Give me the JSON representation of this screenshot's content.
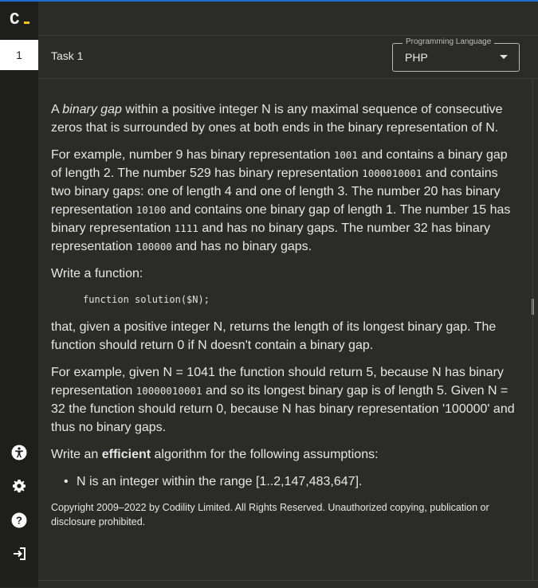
{
  "app": {
    "logo_text": "C",
    "task_number": "1"
  },
  "header": {
    "task_title": "Task 1",
    "language_label": "Programming Language",
    "language_value": "PHP"
  },
  "content": {
    "p1_pre": "A ",
    "p1_em": "binary gap",
    "p1_post": " within a positive integer N is any maximal sequence of consecutive zeros that is surrounded by ones at both ends in the binary representation of N.",
    "p2_a": "For example, number 9 has binary representation ",
    "p2_c1": "1001",
    "p2_b": " and contains a binary gap of length 2. The number 529 has binary representation ",
    "p2_c2": "1000010001",
    "p2_c": " and contains two binary gaps: one of length 4 and one of length 3. The number 20 has binary representation ",
    "p2_c3": "10100",
    "p2_d": " and contains one binary gap of length 1. The number 15 has binary representation ",
    "p2_c4": "1111",
    "p2_e": " and has no binary gaps. The number 32 has binary representation ",
    "p2_c5": "100000",
    "p2_f": " and has no binary gaps.",
    "p3": "Write a function:",
    "code": "function solution($N);",
    "p4": "that, given a positive integer N, returns the length of its longest binary gap. The function should return 0 if N doesn't contain a binary gap.",
    "p5_a": "For example, given N = 1041 the function should return 5, because N has binary representation ",
    "p5_c1": "10000010001",
    "p5_b": " and so its longest binary gap is of length 5. Given N = 32 the function should return 0, because N has binary representation '100000' and thus no binary gaps.",
    "p6_pre": "Write an ",
    "p6_strong": "efficient",
    "p6_post": " algorithm for the following assumptions:",
    "assumption_1": "N is an integer within the range [1..2,147,483,647].",
    "copyright": "Copyright 2009–2022 by Codility Limited. All Rights Reserved. Unauthorized copying, publication or disclosure prohibited."
  },
  "icons": {
    "accessibility": "accessibility-icon",
    "settings": "gear-icon",
    "help": "help-icon",
    "logout": "logout-icon"
  },
  "colors": {
    "accent": "#1f6fd1",
    "logo_dash": "#f5c518",
    "background": "#2b2b28",
    "sidebar": "#1e1e1c"
  }
}
